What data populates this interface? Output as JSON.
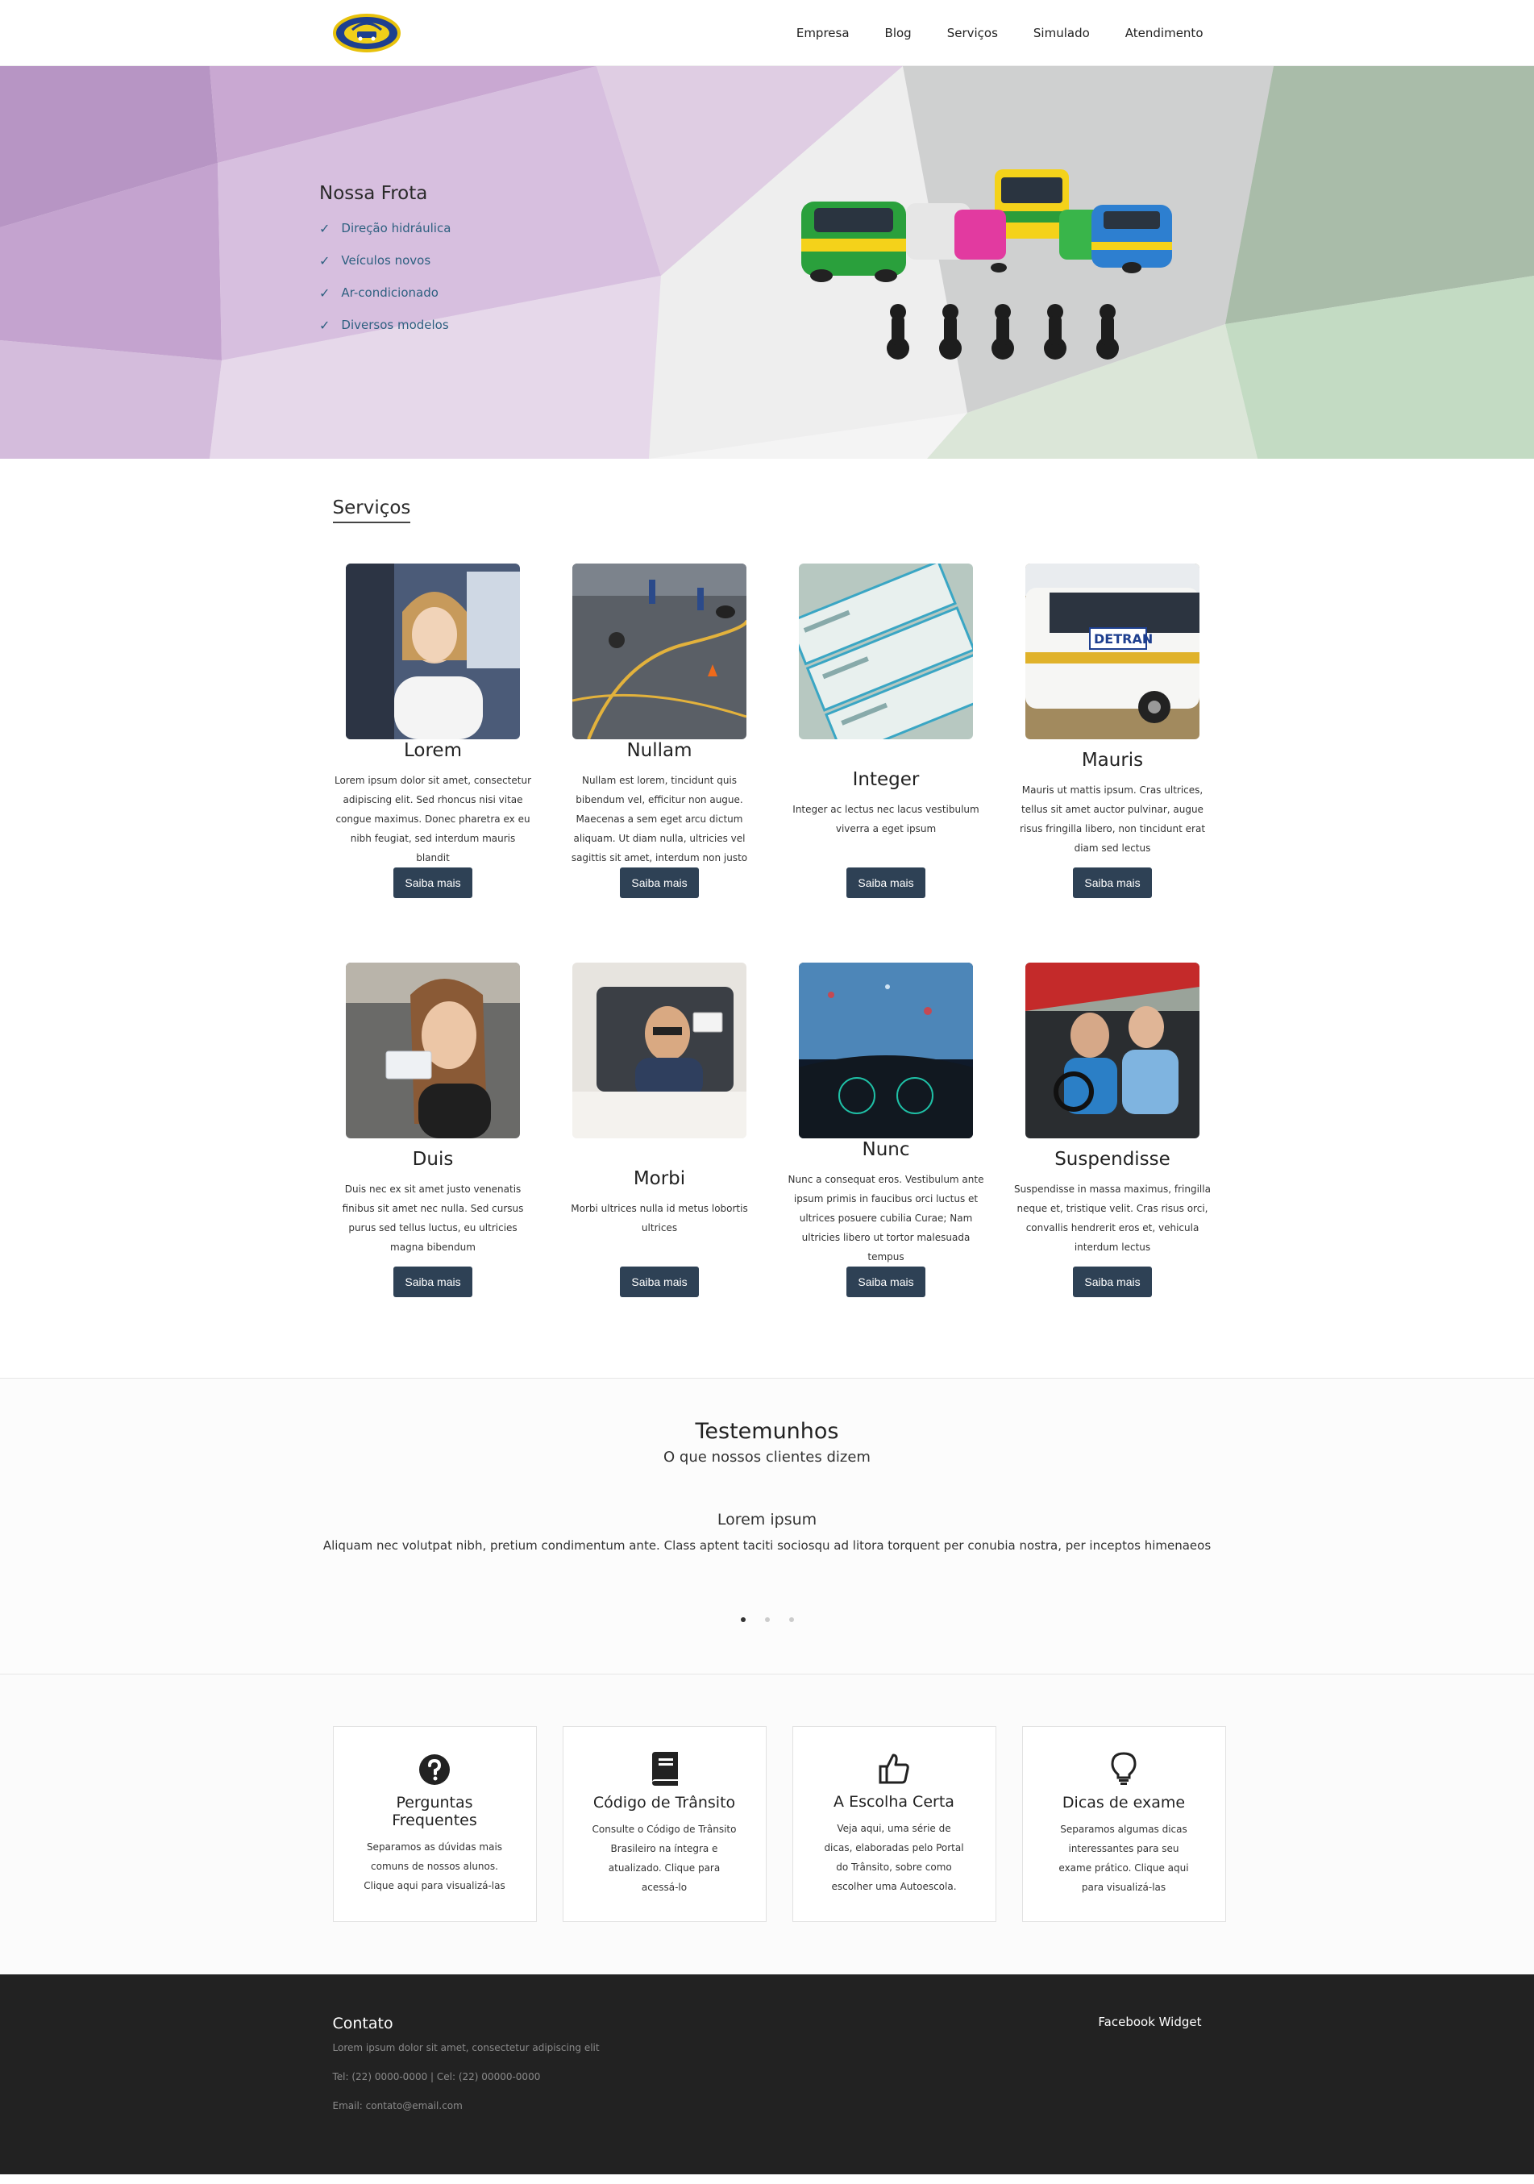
{
  "nav": {
    "items": [
      "Empresa",
      "Blog",
      "Serviços",
      "Simulado",
      "Atendimento"
    ]
  },
  "hero": {
    "title": "Nossa Frota",
    "items": [
      "Direção hidráulica",
      "Veículos novos",
      "Ar-condicionado",
      "Diversos modelos"
    ]
  },
  "services": {
    "title": "Serviços",
    "button_label": "Saiba mais",
    "items": [
      {
        "title": "Lorem",
        "text": "Lorem ipsum dolor sit amet, consectetur adipiscing elit. Sed rhoncus nisi vitae congue maximus. Donec pharetra ex eu nibh feugiat, sed interdum mauris blandit"
      },
      {
        "title": "Nullam",
        "text": "Nullam est lorem, tincidunt quis bibendum vel, efficitur non augue. Maecenas a sem eget arcu dictum aliquam. Ut diam nulla, ultricies vel sagittis sit amet, interdum non justo"
      },
      {
        "title": "Integer",
        "text": "Integer ac lectus nec lacus vestibulum viverra a eget ipsum"
      },
      {
        "title": "Mauris",
        "text": "Mauris ut mattis ipsum. Cras ultrices, tellus sit amet auctor pulvinar, augue risus fringilla libero, non tincidunt erat diam sed lectus"
      },
      {
        "title": "Duis",
        "text": "Duis nec ex sit amet justo venenatis finibus sit amet nec nulla. Sed cursus purus sed tellus luctus, eu ultricies magna bibendum"
      },
      {
        "title": "Morbi",
        "text": "Morbi ultrices nulla id metus lobortis ultrices"
      },
      {
        "title": "Nunc",
        "text": "Nunc a consequat eros. Vestibulum ante ipsum primis in faucibus orci luctus et ultrices posuere cubilia Curae; Nam ultricies libero ut tortor malesuada tempus"
      },
      {
        "title": "Suspendisse",
        "text": "Suspendisse in massa maximus, fringilla neque et, tristique velit. Cras risus orci, convallis hendrerit eros et, vehicula interdum lectus"
      }
    ]
  },
  "testimonials": {
    "title": "Testemunhos",
    "subtitle": "O que nossos clientes dizem",
    "quote_title": "Lorem ipsum",
    "quote_body": "Aliquam nec volutpat nibh, pretium condimentum ante. Class aptent taciti sociosqu ad litora torquent per conubia nostra, per inceptos himenaeos",
    "active_slide": 1,
    "slide_count": 3
  },
  "features": [
    {
      "icon": "question-circle-icon",
      "title": "Perguntas Frequentes",
      "text": "Separamos as dúvidas mais comuns de nossos alunos. Clique aqui para visualizá-las"
    },
    {
      "icon": "book-icon",
      "title": "Código de Trânsito",
      "text": "Consulte o Código de Trânsito Brasileiro na íntegra e atualizado. Clique para acessá-lo"
    },
    {
      "icon": "thumbs-up-icon",
      "title": "A Escolha Certa",
      "text": "Veja aqui, uma série de dicas, elaboradas pelo Portal do Trânsito, sobre como escolher uma Autoescola."
    },
    {
      "icon": "lightbulb-icon",
      "title": "Dicas de exame",
      "text": "Separamos algumas dicas interessantes para seu exame prático. Clique aqui para visualizá-las"
    }
  ],
  "footer": {
    "title": "Contato",
    "line1": "Lorem ipsum dolor sit amet, consectetur adipiscing elit",
    "line2": "Tel: (22) 0000-0000 | Cel: (22) 00000-0000",
    "line3": "Email: contato@email.com",
    "widget": "Facebook Widget"
  },
  "colors": {
    "button": "#2e4155",
    "hero_list": "#2e6080",
    "footer_bg": "#222222"
  }
}
